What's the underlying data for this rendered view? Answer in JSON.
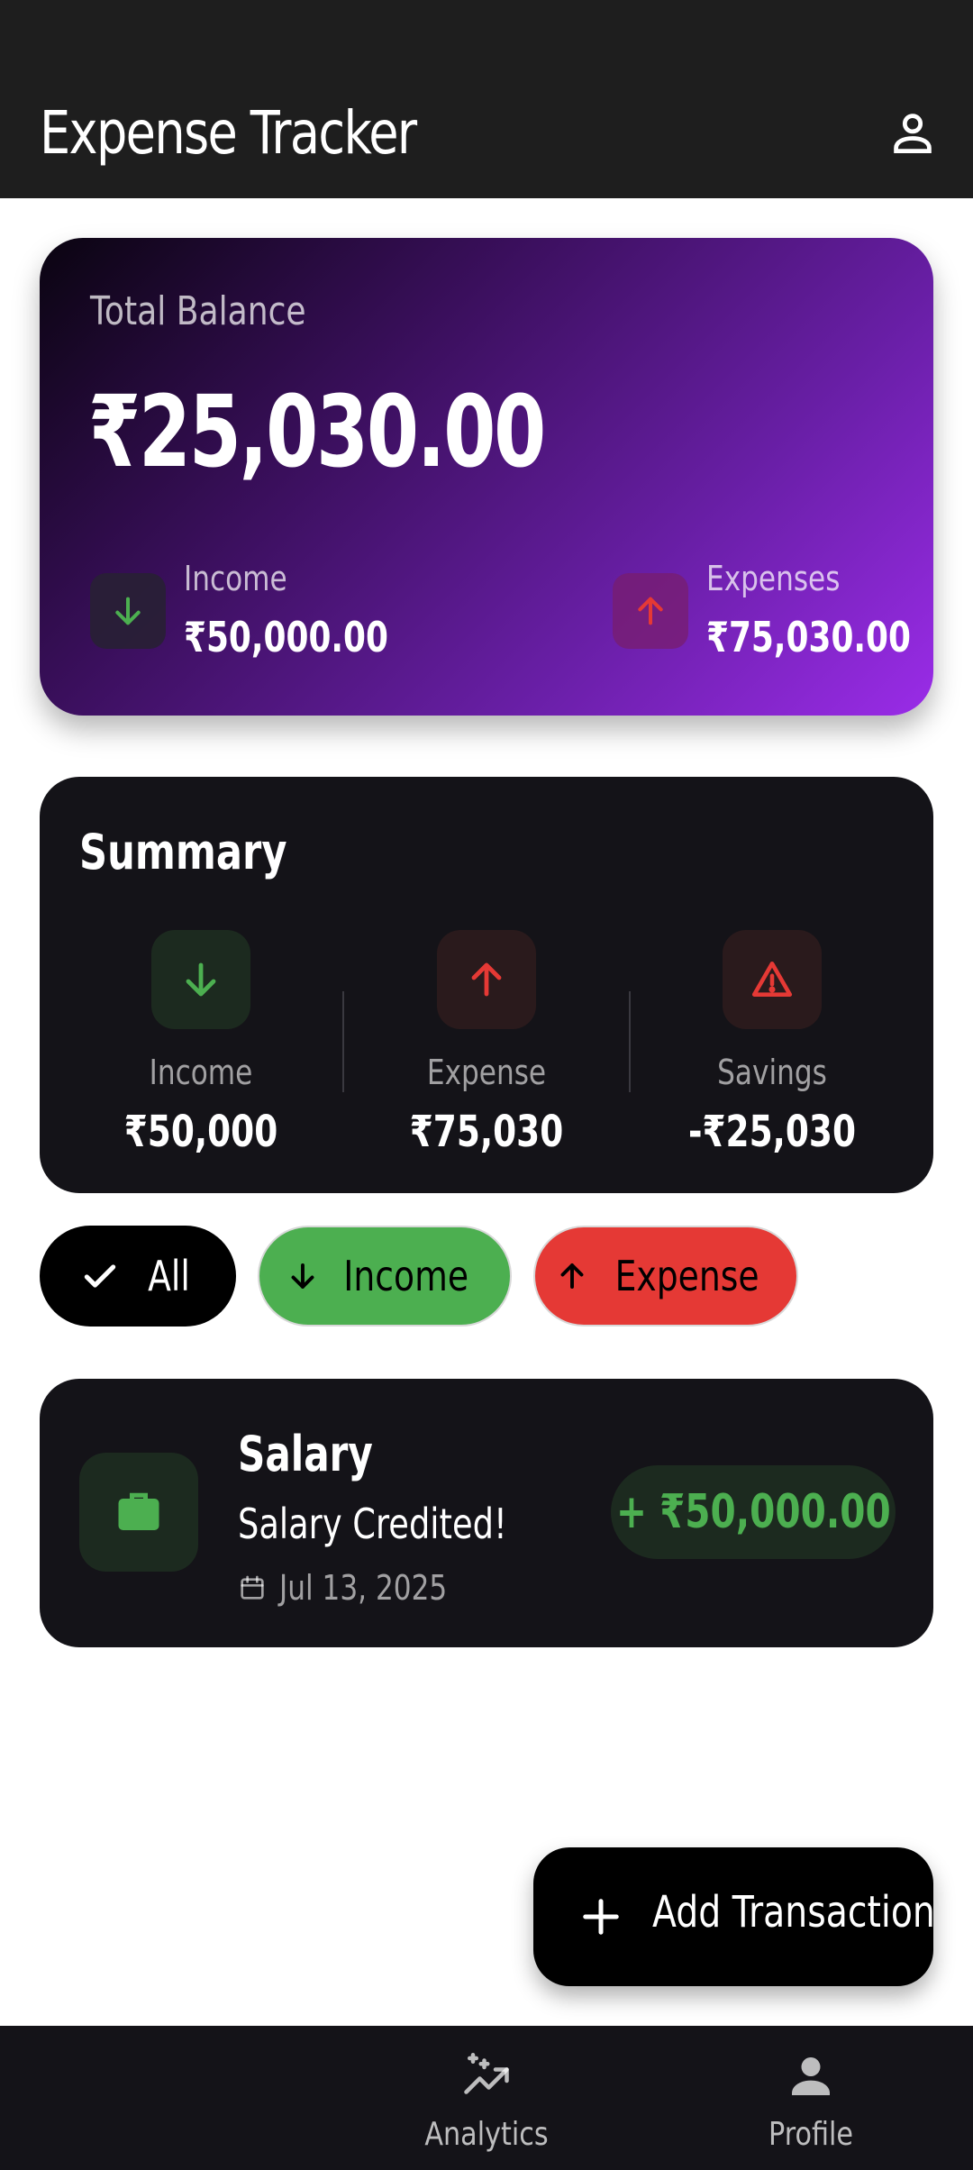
{
  "app": {
    "title": "Expense Tracker",
    "profile_icon": "person-outline-icon"
  },
  "balance_card": {
    "label": "Total Balance",
    "amount": "₹25,030.00",
    "income": {
      "label": "Income",
      "value": "₹50,000.00",
      "icon": "arrow-down-icon",
      "color": "#4caf50"
    },
    "expenses": {
      "label": "Expenses",
      "value": "₹75,030.00",
      "icon": "arrow-up-icon",
      "color": "#e53935"
    }
  },
  "summary": {
    "title": "Summary",
    "items": [
      {
        "label": "Income",
        "value": "₹50,000",
        "icon": "arrow-down-icon",
        "color": "#4caf50"
      },
      {
        "label": "Expense",
        "value": "₹75,030",
        "icon": "arrow-up-icon",
        "color": "#e53935"
      },
      {
        "label": "Savings",
        "value": "-₹25,030",
        "icon": "warning-icon",
        "color": "#e53935"
      }
    ]
  },
  "filters": {
    "all": {
      "label": "All",
      "icon": "check-icon",
      "selected": true,
      "color": "#000000"
    },
    "income": {
      "label": "Income",
      "icon": "arrow-down-icon",
      "color": "#4caf50"
    },
    "expense": {
      "label": "Expense",
      "icon": "arrow-up-icon",
      "color": "#e53935"
    }
  },
  "transactions": [
    {
      "category": "Salary",
      "note": "Salary Credited!",
      "date": "Jul 13, 2025",
      "amount": "+ ₹50,000.00",
      "icon": "briefcase-icon",
      "color": "#4caf50"
    }
  ],
  "fab": {
    "label": "Add Transaction",
    "icon": "plus-icon"
  },
  "bottom_nav": {
    "items": [
      {
        "label": "Analytics",
        "icon": "analytics-sparkle-icon"
      },
      {
        "label": "Profile",
        "icon": "person-filled-icon"
      }
    ]
  }
}
